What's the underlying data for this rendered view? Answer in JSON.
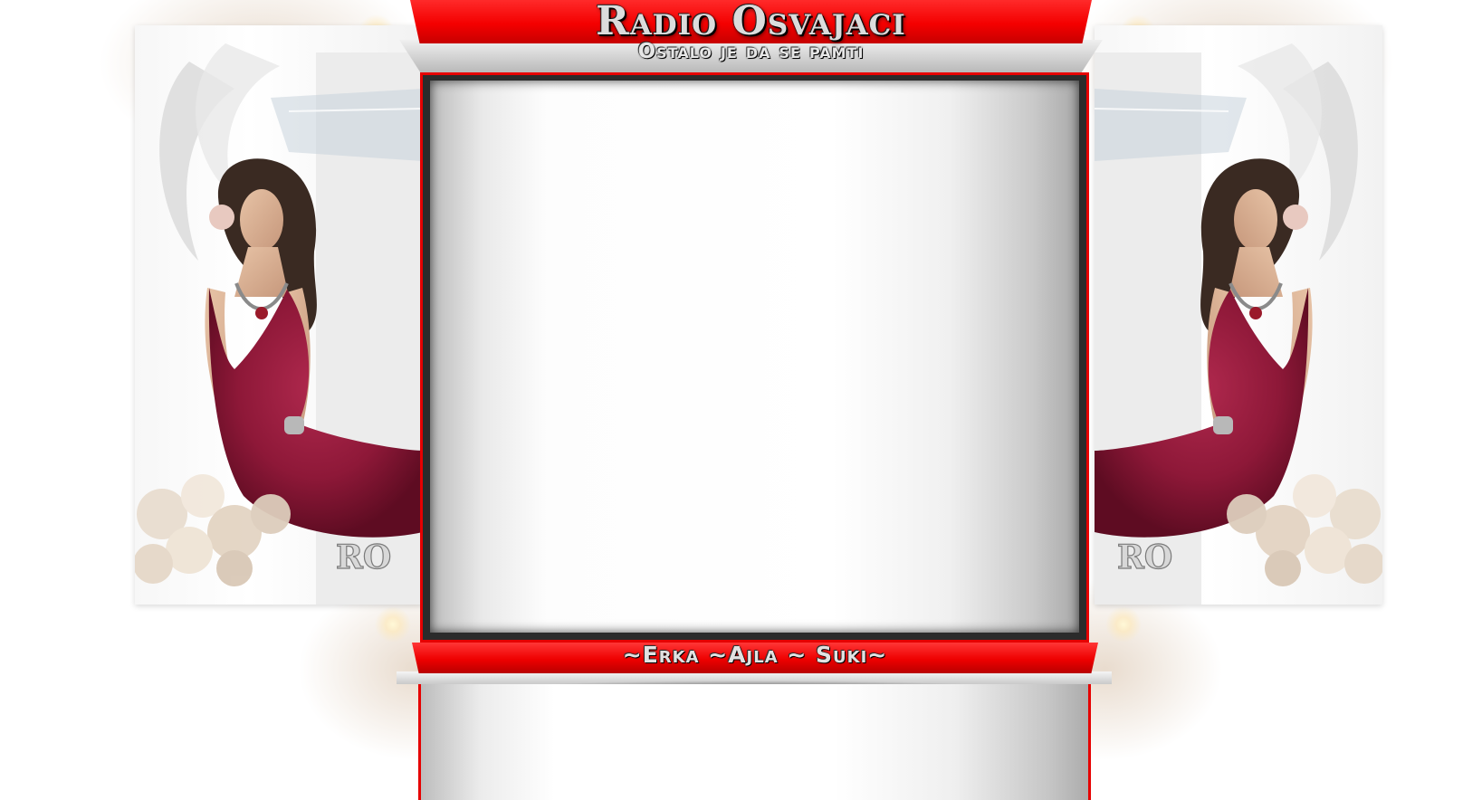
{
  "header": {
    "title": "Radio Osvajaci",
    "subtitle": "Ostalo je da se pamti"
  },
  "footer": {
    "credits": "~Erka ~Ajla ~ Suki~"
  },
  "side_panels": {
    "watermark": "RO"
  },
  "colors": {
    "accent_red": "#e60000",
    "dress_burgundy": "#8e1838",
    "frame_dark": "#2b2b2b"
  }
}
